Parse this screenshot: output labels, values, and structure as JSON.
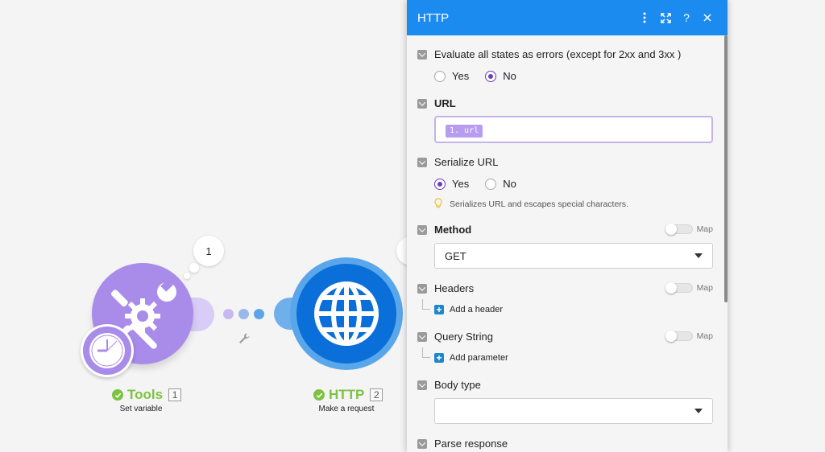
{
  "canvas": {
    "bubble_count": "1",
    "modules": [
      {
        "name": "Tools",
        "number": "1",
        "subtitle": "Set variable"
      },
      {
        "name": "HTTP",
        "number": "2",
        "subtitle": "Make a request"
      }
    ]
  },
  "panel": {
    "title": "HTTP",
    "evaluate": {
      "label": "Evaluate all states as errors (except for 2xx and 3xx )",
      "options": [
        "Yes",
        "No"
      ],
      "selected": "No"
    },
    "url": {
      "label": "URL",
      "token": "1. url"
    },
    "serialize": {
      "label": "Serialize URL",
      "options": [
        "Yes",
        "No"
      ],
      "selected": "Yes",
      "hint": "Serializes URL and escapes special characters."
    },
    "method": {
      "label": "Method",
      "map_label": "Map",
      "value": "GET"
    },
    "headers": {
      "label": "Headers",
      "map_label": "Map",
      "add_label": "Add a header"
    },
    "query": {
      "label": "Query String",
      "map_label": "Map",
      "add_label": "Add parameter"
    },
    "body_type": {
      "label": "Body type",
      "value": ""
    },
    "parse_response": {
      "label": "Parse response"
    }
  },
  "colors": {
    "header_blue": "#1c8bf0",
    "tools_purple": "#a98bea",
    "http_blue": "#0a6fd9",
    "success_green": "#7dc242",
    "radio_purple": "#6a3fb8"
  }
}
